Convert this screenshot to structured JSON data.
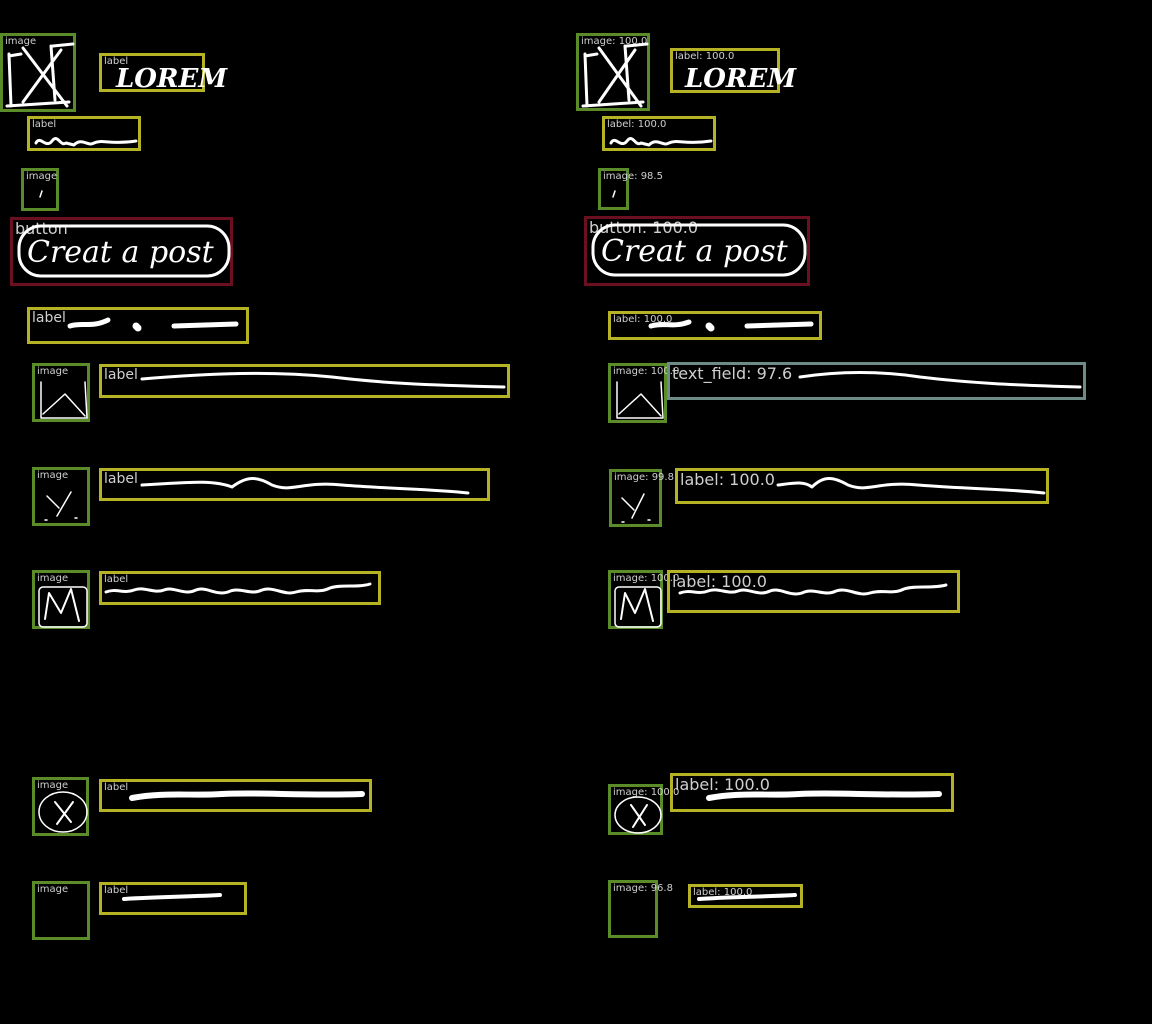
{
  "left": {
    "header_image_tag": "image",
    "logo_label_tag": "label",
    "logo_text": "LOREM",
    "sub_label_tag": "label",
    "small_image_tag": "image",
    "button_tag": "button",
    "button_text": "Creat a post",
    "dots_label_tag": "label",
    "rows": [
      {
        "image_tag": "image",
        "label_tag": "label"
      },
      {
        "image_tag": "image",
        "label_tag": "label"
      },
      {
        "image_tag": "image",
        "label_tag": "label"
      },
      {
        "image_tag": "image",
        "label_tag": "label"
      },
      {
        "image_tag": "image",
        "label_tag": "label"
      }
    ]
  },
  "right": {
    "header_image_tag": "image: 100.0",
    "logo_label_tag": "label: 100.0",
    "logo_text": "LOREM",
    "sub_label_tag": "label: 100.0",
    "small_image_tag": "image: 98.5",
    "button_tag": "button: 100.0",
    "button_text": "Creat a post",
    "dots_label_tag": "label: 100.0",
    "rows": [
      {
        "image_tag": "image: 100.0",
        "label_tag": "text_field: 97.6"
      },
      {
        "image_tag": "image: 99.8",
        "label_tag": "label: 100.0"
      },
      {
        "image_tag": "image: 100.0",
        "label_tag": "label: 100.0"
      },
      {
        "image_tag": "image: 100.0",
        "label_tag": "label: 100.0"
      },
      {
        "image_tag": "image: 96.8",
        "label_tag": "label: 100.0"
      }
    ]
  },
  "colors": {
    "image_box": "#5a8c2a",
    "label_box": "#b5b223",
    "button_box": "#6b1020",
    "text_field_box": "#6e8c86",
    "ink": "#ffffff",
    "background": "#000000"
  }
}
